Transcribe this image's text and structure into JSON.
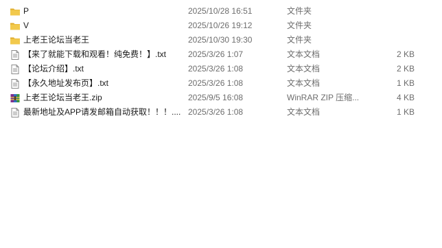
{
  "files": [
    {
      "name": "P",
      "modified": "2025/10/28 16:51",
      "type": "文件夹",
      "size": "",
      "icon": "folder-icon"
    },
    {
      "name": "V",
      "modified": "2025/10/26 19:12",
      "type": "文件夹",
      "size": "",
      "icon": "folder-icon"
    },
    {
      "name": "上老王论坛当老王",
      "modified": "2025/10/30 19:30",
      "type": "文件夹",
      "size": "",
      "icon": "folder-icon"
    },
    {
      "name": "【来了就能下载和观看！纯免费！】.txt",
      "modified": "2025/3/26 1:07",
      "type": "文本文档",
      "size": "2 KB",
      "icon": "text-file-icon"
    },
    {
      "name": "【论坛介绍】.txt",
      "modified": "2025/3/26 1:08",
      "type": "文本文档",
      "size": "2 KB",
      "icon": "text-file-icon"
    },
    {
      "name": "【永久地址发布页】.txt",
      "modified": "2025/3/26 1:08",
      "type": "文本文档",
      "size": "1 KB",
      "icon": "text-file-icon"
    },
    {
      "name": "上老王论坛当老王.zip",
      "modified": "2025/9/5 16:08",
      "type": "WinRAR ZIP 压缩...",
      "size": "4 KB",
      "icon": "winrar-zip-icon"
    },
    {
      "name": "最新地址及APP请发邮箱自动获取！！！....",
      "modified": "2025/3/26 1:08",
      "type": "文本文档",
      "size": "1 KB",
      "icon": "text-file-icon"
    }
  ],
  "colors": {
    "folder": "#f2c94c",
    "folder_dark": "#e0ad2e",
    "text_primary": "#1a1a1a",
    "text_secondary": "#6d6d6d"
  }
}
